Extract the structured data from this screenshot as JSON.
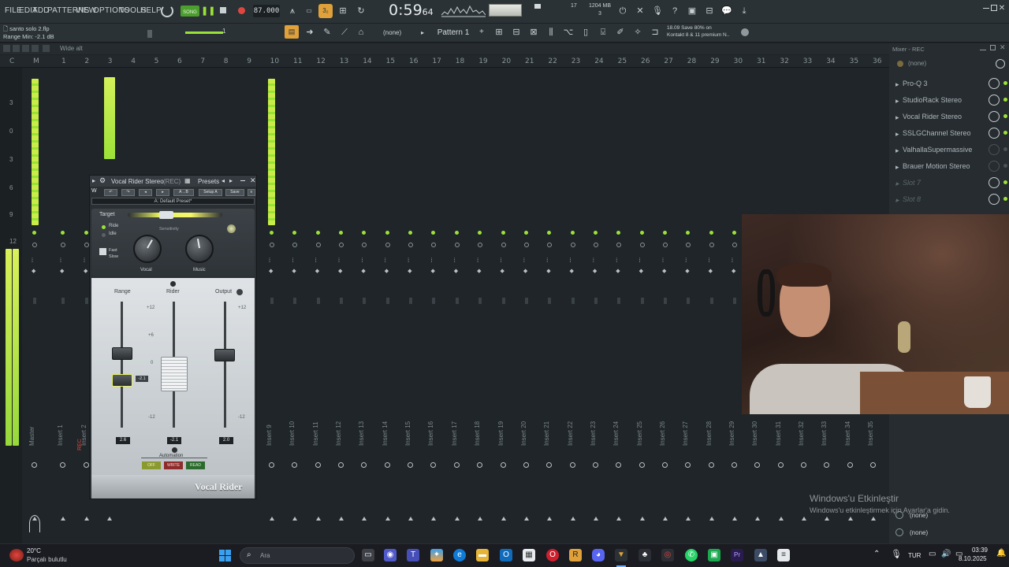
{
  "menu": [
    "FILE",
    "EDIT",
    "ADD",
    "PATTERNS",
    "VIEW",
    "OPTIONS",
    "TOOLS",
    "HELP"
  ],
  "transport": {
    "song_label": "SONG",
    "tempo": "87.000",
    "time": "0:59",
    "time_frames": "64",
    "mem": "1204 MB",
    "cpu_top": "17",
    "cpu_bottom": "3"
  },
  "info": {
    "project": "santo solo 2.flp",
    "hint": "Range Min: -2.1 dB",
    "news_line1": "18.09  Save 80% on",
    "news_line2": "Kontakt 8 & 11 premium N.."
  },
  "toolbar2": {
    "pattern": "Pattern 1",
    "none": "(none)",
    "snap_label": "Wide alt"
  },
  "ruler": [
    "C",
    "M",
    "1",
    "2",
    "3",
    "4",
    "5",
    "6",
    "7",
    "8",
    "9",
    "10",
    "11",
    "12",
    "13",
    "14",
    "15",
    "16",
    "17",
    "18",
    "19",
    "20",
    "21",
    "22",
    "23",
    "24",
    "25",
    "26",
    "27",
    "28",
    "29",
    "30",
    "31",
    "32",
    "33",
    "34",
    "35",
    "36"
  ],
  "left_scale": [
    "3",
    "0",
    "3",
    "6",
    "9",
    "12"
  ],
  "inserts": [
    "Master",
    "Insert 1",
    "Insert 2",
    "Insert 3",
    "Insert 9",
    "Insert 10",
    "Insert 11",
    "Insert 12",
    "Insert 13",
    "Insert 14",
    "Insert 15",
    "Insert 16",
    "Insert 17",
    "Insert 18",
    "Insert 19",
    "Insert 20",
    "Insert 21",
    "Insert 22",
    "Insert 23",
    "Insert 24",
    "Insert 25",
    "Insert 26",
    "Insert 27",
    "Insert 28",
    "Insert 29",
    "Insert 30",
    "Insert 31",
    "Insert 32",
    "Insert 33",
    "Insert 34",
    "Insert 35",
    "Insert 36"
  ],
  "rec_label": "REC",
  "mixer_panel": {
    "title": "Mixer - REC",
    "input": "(none)",
    "slots": [
      "Pro-Q 3",
      "StudioRack Stereo",
      "Vocal Rider Stereo",
      "SSLGChannel Stereo",
      "ValhallaSupermassive",
      "Brauer Motion Stereo",
      "Slot 7",
      "Slot 8"
    ],
    "output": "(none)",
    "output2": "(none)"
  },
  "plugin": {
    "title": "Vocal Rider Stereo",
    "rec": "(REC)",
    "presets": "Presets",
    "preset_name": "A: Default Preset*",
    "buttons": [
      "Setup A",
      "Save"
    ],
    "target": "Target",
    "ride": "Ride",
    "idle": "Idle",
    "sensitivity": "Sensitivity",
    "fast": "Fast",
    "slow": "Slow",
    "vocal": "Vocal",
    "music": "Music",
    "range": "Range",
    "rider": "Rider",
    "output": "Output",
    "scale": [
      "+12",
      "+6",
      "0",
      "-6",
      "-12"
    ],
    "range_val": "2.6",
    "rider_val": "-2.1",
    "output_val": "2.0",
    "range_min_tag": "-2.1",
    "automation": "Automation",
    "auto_buttons": [
      "OFF",
      "WRITE",
      "READ"
    ],
    "brand": "Vocal Rider"
  },
  "activation": {
    "line1": "Windows'u Etkinleştir",
    "line2": "Windows'u etkinleştirmek için Ayarlar'a gidin."
  },
  "taskbar": {
    "weather_temp": "20°C",
    "weather_desc": "Parçalı bulutlu",
    "search": "Ara",
    "lang": "TUR",
    "clock": "03:39",
    "date": "8.10.2025"
  }
}
